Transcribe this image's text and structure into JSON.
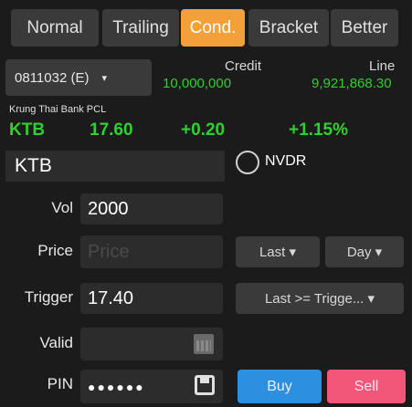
{
  "tabs": [
    {
      "label": "Normal"
    },
    {
      "label": "Trailing"
    },
    {
      "label": "Cond."
    },
    {
      "label": "Bracket"
    },
    {
      "label": "Better"
    }
  ],
  "active_tab": "Cond.",
  "account": {
    "value": "0811032 (E)",
    "caret": "▾"
  },
  "credit": {
    "label": "Credit",
    "value": "10,000,000"
  },
  "line": {
    "label": "Line",
    "value": "9,921,868.30"
  },
  "company_name": "Krung Thai Bank PCL",
  "quote": {
    "symbol": "KTB",
    "price": "17.60",
    "change": "+0.20",
    "pct": "+1.15%"
  },
  "symbol_input": {
    "value": "KTB"
  },
  "nvdr_label": "NVDR",
  "form": {
    "vol_label": "Vol",
    "vol_value": "2000",
    "price_label": "Price",
    "price_placeholder": "Price",
    "price_type": "Last ▾",
    "validity": "Day ▾",
    "trigger_label": "Trigger",
    "trigger_value": "17.40",
    "trigger_condition": "Last >= Trigge... ▾",
    "valid_label": "Valid",
    "pin_label": "PIN",
    "pin_value": "●●●●●●"
  },
  "buttons": {
    "buy": "Buy",
    "sell": "Sell"
  },
  "colors": {
    "accent": "#f2a13a",
    "positive": "#2ed12e",
    "buy": "#2d8fe0",
    "sell": "#f25678"
  }
}
